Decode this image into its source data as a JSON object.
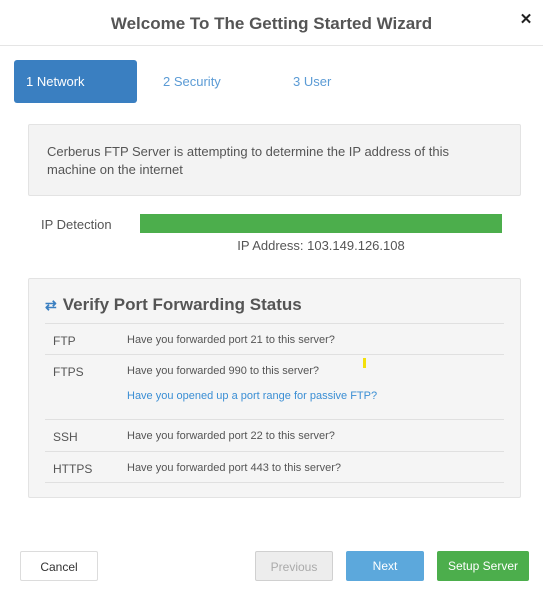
{
  "header": {
    "title": "Welcome To The Getting Started Wizard",
    "close_glyph": "✕"
  },
  "tabs": [
    {
      "label": "1 Network"
    },
    {
      "label": "2 Security"
    },
    {
      "label": "3 User"
    }
  ],
  "info_message": "Cerberus FTP Server is attempting to determine the IP address of this machine on the internet",
  "ip_detection": {
    "label": "IP Detection",
    "progress_percent": 100,
    "address_text": "IP Address: 103.149.126.108",
    "bar_color": "#4cae4c"
  },
  "port_forwarding": {
    "title": "Verify Port Forwarding Status",
    "title_icon": "swap-arrows-icon",
    "rows": [
      {
        "protocol": "FTP",
        "question": "Have you forwarded port 21 to this server?"
      },
      {
        "protocol": "FTPS",
        "question": "Have you forwarded 990 to this server?",
        "link": "Have you opened up a port range for passive FTP?"
      },
      {
        "protocol": "SSH",
        "question": "Have you forwarded port 22 to this server?"
      },
      {
        "protocol": "HTTPS",
        "question": "Have you forwarded port 443 to this server?"
      }
    ]
  },
  "buttons": {
    "cancel": "Cancel",
    "previous": "Previous",
    "next": "Next",
    "setup": "Setup Server"
  },
  "colors": {
    "accent": "#3a7fc1",
    "success": "#4cae4c",
    "next": "#5ca8dc"
  }
}
